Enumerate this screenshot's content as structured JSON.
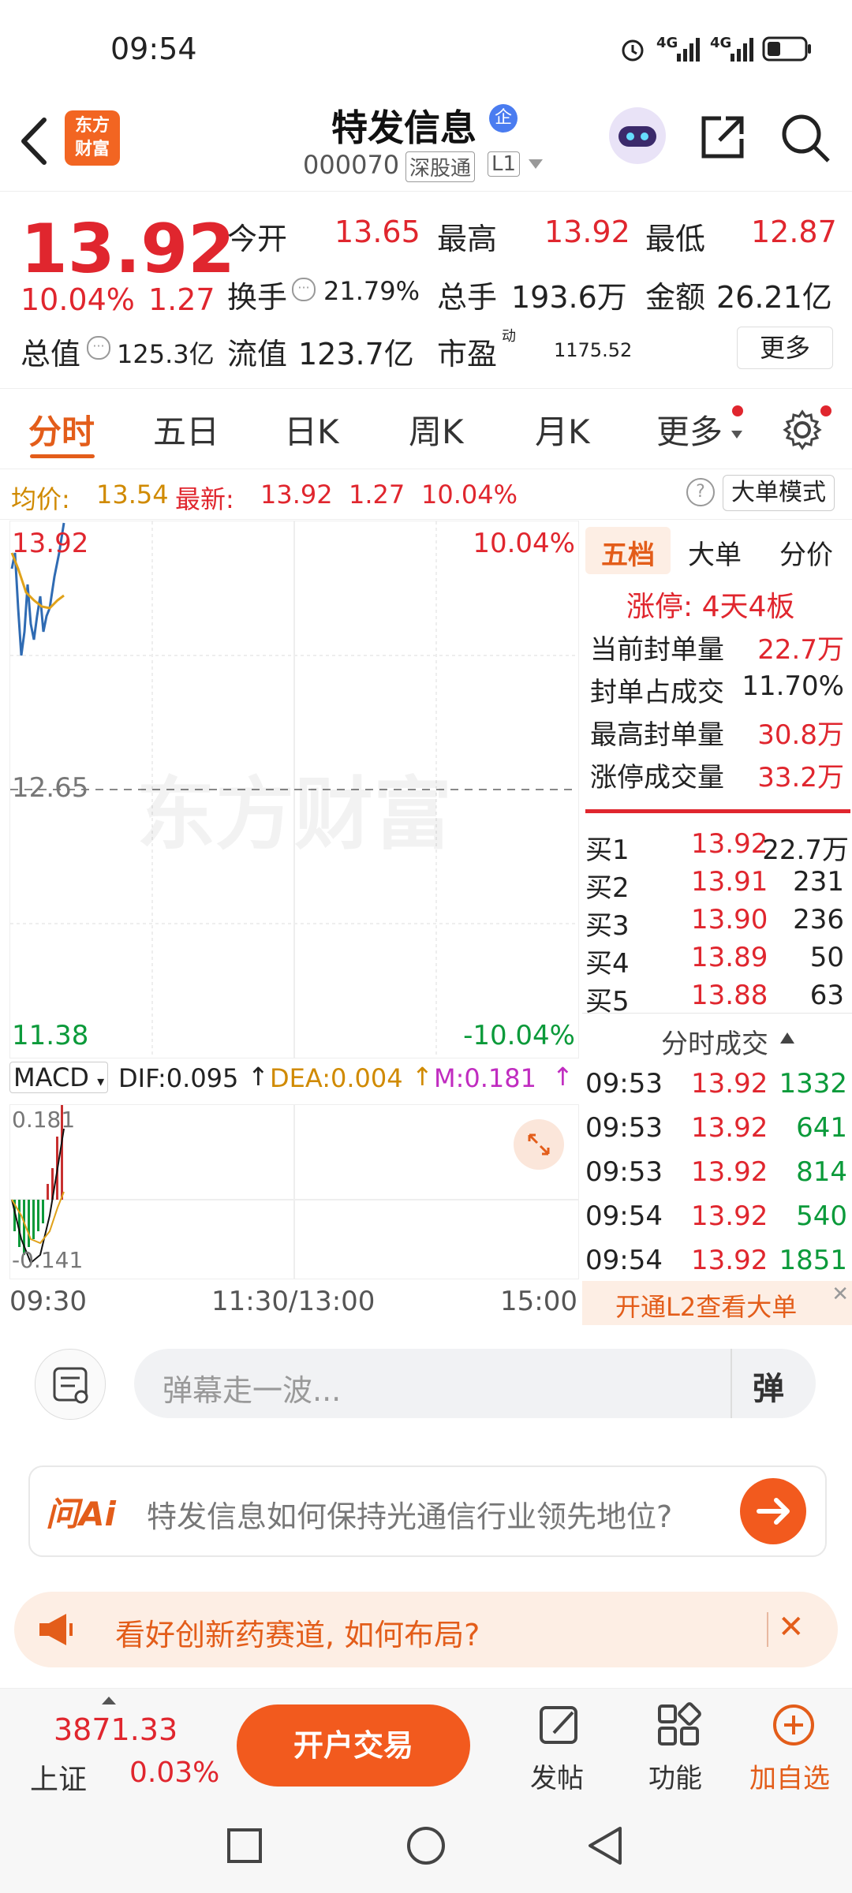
{
  "status": {
    "time": "09:54",
    "network1": "4G",
    "network2": "4G"
  },
  "header": {
    "logo_line1": "东方",
    "logo_line2": "财富",
    "stock_name": "特发信息",
    "badge": "企",
    "stock_code": "000070",
    "connect_tag": "深股通",
    "level_tag": "L1"
  },
  "quote": {
    "price": "13.92",
    "change_pct": "10.04%",
    "change": "1.27",
    "open_label": "今开",
    "open": "13.65",
    "high_label": "最高",
    "high": "13.92",
    "low_label": "最低",
    "low": "12.87",
    "turnover_label": "换手",
    "turnover": "21.79%",
    "volume_label": "总手",
    "volume": "193.6万",
    "amount_label": "金额",
    "amount": "26.21亿",
    "mktcap_label": "总值",
    "mktcap": "125.3亿",
    "float_label": "流值",
    "float_cap": "123.7亿",
    "pe_label": "市盈",
    "pe_sup": "动",
    "pe": "1175.52",
    "more_label": "更多"
  },
  "tabs": [
    "分时",
    "五日",
    "日K",
    "周K",
    "月K",
    "更多"
  ],
  "avg_line": {
    "avg_label": "均价:",
    "avg": "13.54",
    "latest_label": "最新:",
    "latest": "13.92",
    "chg": "1.27",
    "pct": "10.04%",
    "mode_button": "大单模式"
  },
  "chart": {
    "top_price": "13.92",
    "top_pct": "10.04%",
    "mid_price": "12.65",
    "bottom_price": "11.38",
    "bottom_pct": "-10.04%",
    "watermark": "东方财富",
    "time_start": "09:30",
    "time_mid": "11:30/13:00",
    "time_end": "15:00"
  },
  "macd": {
    "label": "MACD",
    "dif": "DIF:0.095",
    "dea": "DEA:0.004",
    "m": "M:0.181",
    "top": "0.181",
    "bottom": "-0.141"
  },
  "order_panel": {
    "tabs": [
      "五档",
      "大单",
      "分价"
    ],
    "limit_up": "涨停: 4天4板",
    "stats": [
      {
        "label": "当前封单量",
        "value": "22.7万"
      },
      {
        "label": "封单占成交",
        "value": "11.70%"
      },
      {
        "label": "最高封单量",
        "value": "30.8万"
      },
      {
        "label": "涨停成交量",
        "value": "33.2万"
      }
    ],
    "bids": [
      {
        "label": "买1",
        "price": "13.92",
        "vol": "22.7万"
      },
      {
        "label": "买2",
        "price": "13.91",
        "vol": "231"
      },
      {
        "label": "买3",
        "price": "13.90",
        "vol": "236"
      },
      {
        "label": "买4",
        "price": "13.89",
        "vol": "50"
      },
      {
        "label": "买5",
        "price": "13.88",
        "vol": "63"
      }
    ],
    "trades_title": "分时成交",
    "trades": [
      {
        "time": "09:53",
        "price": "13.92",
        "vol": "1332"
      },
      {
        "time": "09:53",
        "price": "13.92",
        "vol": "641"
      },
      {
        "time": "09:53",
        "price": "13.92",
        "vol": "814"
      },
      {
        "time": "09:54",
        "price": "13.92",
        "vol": "540"
      },
      {
        "time": "09:54",
        "price": "13.92",
        "vol": "1851"
      }
    ],
    "l2_banner": "开通L2查看大单"
  },
  "danmu": {
    "placeholder": "弹幕走一波..."
  },
  "ask_ai": {
    "brand": "问Ai",
    "question": "特发信息如何保持光通信行业领先地位?"
  },
  "promo": {
    "text": "看好创新药赛道, 如何布局?"
  },
  "bottom": {
    "index_value": "3871.33",
    "index_name": "上证",
    "index_pct": "0.03%",
    "open_account": "开户交易",
    "post": "发帖",
    "function": "功能",
    "add_watch": "加自选"
  }
}
